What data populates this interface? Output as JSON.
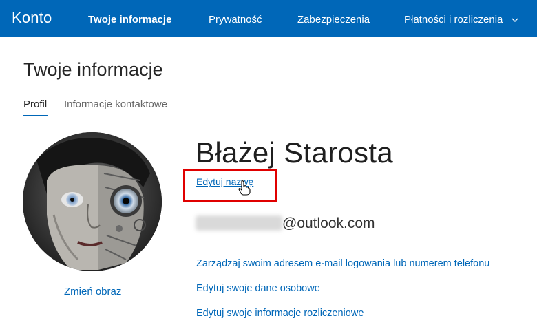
{
  "header": {
    "brand": "Konto",
    "nav": [
      {
        "label": "Twoje informacje"
      },
      {
        "label": "Prywatność"
      },
      {
        "label": "Zabezpieczenia"
      },
      {
        "label": "Płatności i rozliczenia"
      }
    ],
    "background_color": "#0067b8"
  },
  "page": {
    "title": "Twoje informacje",
    "tabs": [
      {
        "label": "Profil"
      },
      {
        "label": "Informacje kontaktowe"
      }
    ]
  },
  "profile": {
    "change_photo_label": "Zmień obraz",
    "full_name": "Błażej Starosta",
    "edit_name_label": "Edytuj nazwę",
    "highlight_color": "#e00000",
    "email_domain": "@outlook.com",
    "links": [
      {
        "label": "Zarządzaj swoim adresem e-mail logowania lub numerem telefonu"
      },
      {
        "label": "Edytuj swoje dane osobowe"
      },
      {
        "label": "Edytuj swoje informacje rozliczeniowe"
      }
    ]
  }
}
